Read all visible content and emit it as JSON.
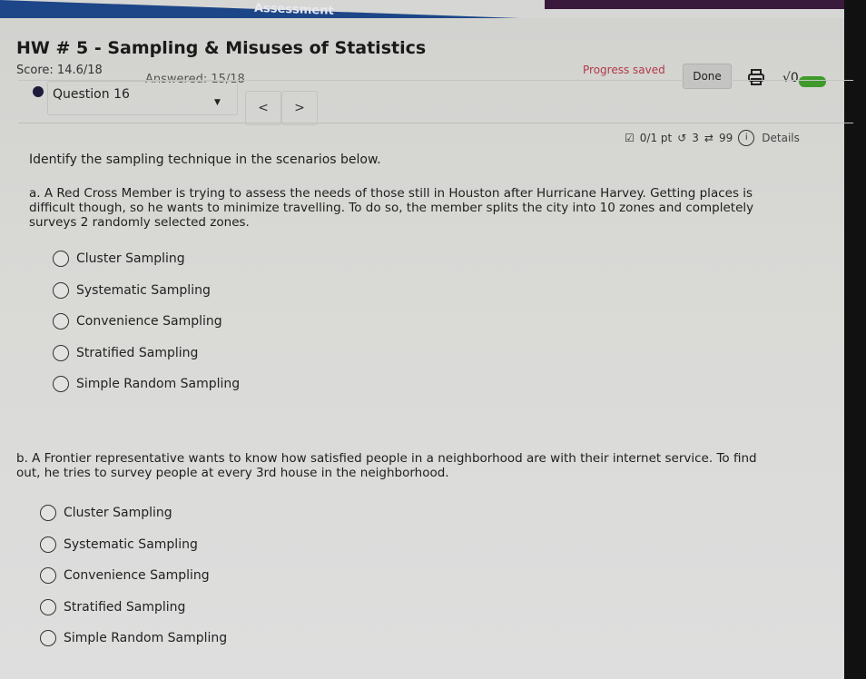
{
  "header": {
    "section_label": "Assessment",
    "title": "HW # 5 - Sampling & Misuses of Statistics",
    "score": "Score: 14.6/18",
    "answered": "Answered: 15/18",
    "progress_status": "Progress saved",
    "done_label": "Done",
    "icons": [
      "printer-icon",
      "sqrt-icon",
      "toggle"
    ],
    "sqrt_glyph": "√0"
  },
  "question_nav": {
    "current": "Question 16",
    "prev_label": "<",
    "next_label": ">"
  },
  "question_meta": {
    "points": "0/1 pt",
    "retries": "3",
    "attempts": "99",
    "details_label": "Details"
  },
  "question": {
    "instruction": "Identify the sampling technique in the scenarios below.",
    "parts": [
      {
        "text": "a. A Red Cross Member is trying to assess the needs of those still in Houston after Hurricane Harvey. Getting places is difficult though, so he wants to minimize travelling. To do so, the member splits the city into 10 zones and completely surveys 2 randomly selected zones.",
        "options": [
          "Cluster Sampling",
          "Systematic Sampling",
          "Convenience Sampling",
          "Stratified Sampling",
          "Simple Random Sampling"
        ]
      },
      {
        "text": "b. A Frontier representative wants to know how satisfied people in a neighborhood are with their internet service. To find out, he tries to survey people at every 3rd house in the neighborhood.",
        "options": [
          "Cluster Sampling",
          "Systematic Sampling",
          "Convenience Sampling",
          "Stratified Sampling",
          "Simple Random Sampling"
        ]
      }
    ]
  },
  "colors": {
    "header_blue": "#1d4688",
    "progress_red": "#b23a48",
    "toggle_green": "#3e9a2a"
  }
}
